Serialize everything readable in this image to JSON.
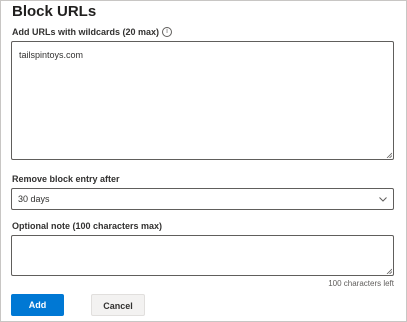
{
  "panel": {
    "title": "Block URLs"
  },
  "urls_field": {
    "label": "Add URLs with wildcards (20 max)",
    "info_icon": "info-icon",
    "value": "tailspintoys.com"
  },
  "remove_field": {
    "label": "Remove block entry after",
    "selected": "30 days",
    "chevron_icon": "chevron-down-icon"
  },
  "note_field": {
    "label": "Optional note (100 characters max)",
    "value": "",
    "chars_left": "100 characters left"
  },
  "actions": {
    "add_label": "Add",
    "cancel_label": "Cancel"
  },
  "colors": {
    "primary": "#0078d4",
    "border": "#605e5c",
    "secondary_button": "#f3f2f1"
  }
}
